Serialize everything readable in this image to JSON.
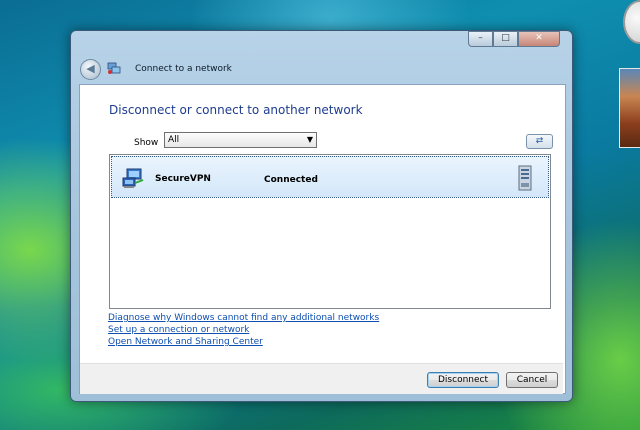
{
  "window": {
    "title": "Connect to a network",
    "caption_buttons": {
      "minimize": "–",
      "maximize": "□",
      "close": "✕"
    }
  },
  "content": {
    "heading": "Disconnect or connect to another network",
    "show_label": "Show",
    "show_value": "All",
    "networks": [
      {
        "name": "SecureVPN",
        "status": "Connected"
      }
    ]
  },
  "links": [
    "Diagnose why Windows cannot find any additional networks",
    "Set up a connection or network",
    "Open Network and Sharing Center"
  ],
  "buttons": {
    "disconnect": "Disconnect",
    "cancel": "Cancel"
  },
  "icons": {
    "back": "back-arrow-icon",
    "refresh": "refresh-icon",
    "network": "vpn-network-icon",
    "server": "server-icon"
  },
  "colors": {
    "heading": "#1e3d8f",
    "link": "#0e4fb0",
    "selection": "#d3e7f9"
  }
}
